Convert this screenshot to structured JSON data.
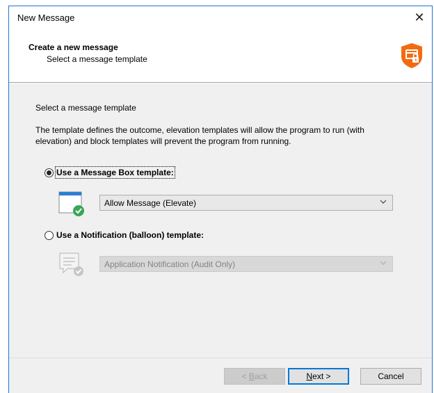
{
  "window": {
    "title": "New Message",
    "close_glyph": "✕"
  },
  "header": {
    "title": "Create a new message",
    "subtitle": "Select a message template",
    "icon": "shield-lock-icon",
    "icon_color": "#f26b10"
  },
  "content": {
    "intro": "Select a message template",
    "description": "The template defines the outcome, elevation templates will allow the program to run (with elevation) and block templates will prevent the program from running."
  },
  "options": {
    "message_box": {
      "label": "Use a Message Box template:",
      "checked": true,
      "select_value": "Allow Message (Elevate)",
      "icon": "message-box-check-icon"
    },
    "notification": {
      "label": "Use a Notification (balloon) template:",
      "checked": false,
      "select_value": "Application Notification (Audit Only)",
      "icon": "notification-balloon-check-icon"
    }
  },
  "buttons": {
    "back_prefix": "< ",
    "back_mnemonic": "B",
    "back_rest": "ack",
    "next_mnemonic": "N",
    "next_rest": "ext >",
    "cancel": "Cancel"
  },
  "colors": {
    "accent": "#0078d7",
    "check_green": "#3aa656"
  }
}
